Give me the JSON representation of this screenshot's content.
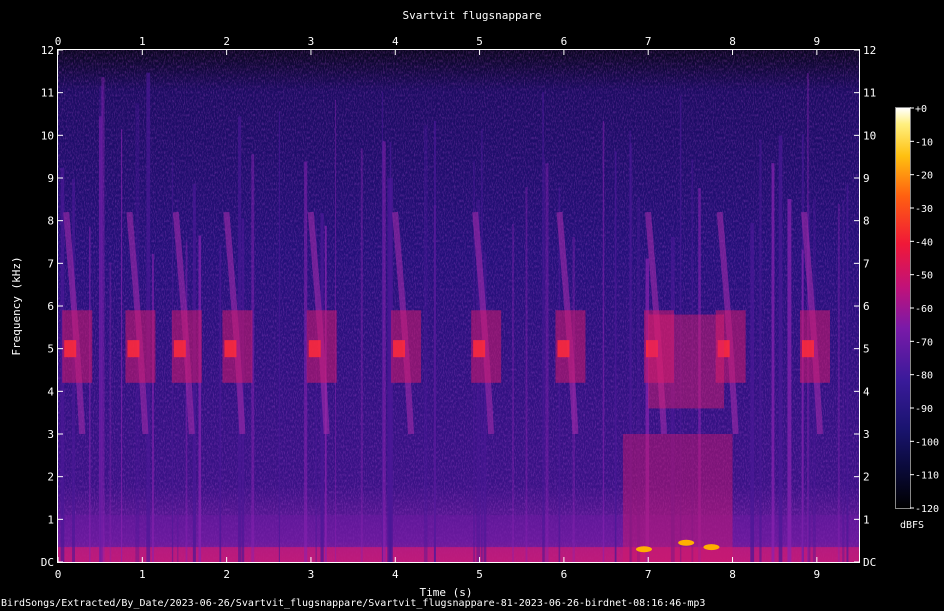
{
  "chart_data": {
    "type": "heatmap",
    "title": "Svartvit flugsnappare",
    "xlabel": "Time (s)",
    "ylabel": "Frequency (kHz)",
    "xlim": [
      0,
      9.5
    ],
    "ylim": [
      0,
      12
    ],
    "x_ticks": [
      "0",
      "1",
      "2",
      "3",
      "4",
      "5",
      "6",
      "7",
      "8",
      "9"
    ],
    "y_ticks": [
      "DC",
      "1",
      "2",
      "3",
      "4",
      "5",
      "6",
      "7",
      "8",
      "9",
      "10",
      "11",
      "12"
    ],
    "colorbar": {
      "label": "dBFS",
      "ticks": [
        "+0",
        "-10",
        "-20",
        "-30",
        "-40",
        "-50",
        "-60",
        "-70",
        "-80",
        "-90",
        "-100",
        "-110",
        "-120"
      ],
      "range": [
        -120,
        0
      ]
    },
    "song_phrases_s": [
      0.05,
      0.8,
      1.35,
      1.95,
      2.95,
      3.95,
      4.9,
      5.9,
      6.95,
      7.8,
      8.8
    ]
  },
  "footer": "BirdSongs/Extracted/By_Date/2023-06-26/Svartvit_flugsnappare/Svartvit_flugsnappare-81-2023-06-26-birdnet-08:16:46-mp3",
  "colors": {
    "background": "#000000",
    "low": "#1a0a5a",
    "mid": "#8a1fa8",
    "high": "#ff2a3a",
    "peak": "#ffd200"
  }
}
